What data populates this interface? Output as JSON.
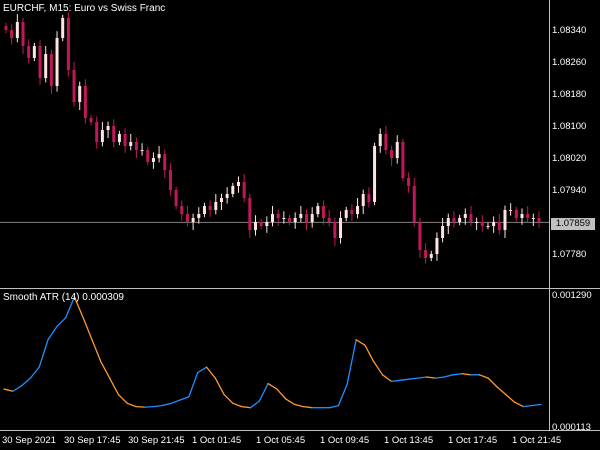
{
  "main_chart": {
    "symbol": "EURCHF",
    "timeframe": "M15",
    "description": "Euro vs Swiss Franc",
    "title_text": "EURCHF, M15:  Euro vs Swiss Franc",
    "current_price": "1.07859",
    "price_labels": [
      "1.08340",
      "1.08260",
      "1.08180",
      "1.08100",
      "1.08020",
      "1.07940",
      "1.07780"
    ],
    "colors": {
      "background": "#000000",
      "bull": "#ffe4e1",
      "bear": "#c2185b",
      "grid": "#808080",
      "price_line": "#808080"
    }
  },
  "indicator": {
    "title_text": "Smooth ATR (14) 0.000309",
    "name": "Smooth ATR",
    "period": "14",
    "value": "0.000309",
    "scale_labels": [
      "0.001290",
      "0.000113"
    ],
    "colors": {
      "rising": "#1e90ff",
      "falling": "#ff9933"
    }
  },
  "time_axis": {
    "labels": [
      "30 Sep 2021",
      "30 Sep 17:45",
      "30 Sep 21:45",
      "1 Oct 01:45",
      "1 Oct 05:45",
      "1 Oct 09:45",
      "1 Oct 13:45",
      "1 Oct 17:45",
      "1 Oct 21:45"
    ]
  },
  "chart_data": [
    {
      "type": "candlestick",
      "title": "EURCHF, M15:  Euro vs Swiss Franc",
      "ylim": [
        1.0773,
        1.0838
      ],
      "close": [
        1.0834,
        1.0832,
        1.0836,
        1.083,
        1.0827,
        1.083,
        1.0822,
        1.0828,
        1.082,
        1.0832,
        1.0837,
        1.0824,
        1.0816,
        1.082,
        1.0812,
        1.0811,
        1.0806,
        1.0809,
        1.081,
        1.0806,
        1.0808,
        1.0805,
        1.0806,
        1.0804,
        1.0804,
        1.0801,
        1.0802,
        1.0803,
        1.0799,
        1.0794,
        1.079,
        1.0788,
        1.0786,
        1.0787,
        1.0788,
        1.079,
        1.0789,
        1.0791,
        1.0792,
        1.0793,
        1.0795,
        1.0796,
        1.0792,
        1.0784,
        1.0786,
        1.0785,
        1.0786,
        1.0788,
        1.0787,
        1.0787,
        1.0786,
        1.0787,
        1.0788,
        1.0786,
        1.0788,
        1.079,
        1.0787,
        1.0786,
        1.0782,
        1.0787,
        1.0789,
        1.0788,
        1.079,
        1.0793,
        1.0791,
        1.0805,
        1.0808,
        1.0804,
        1.0802,
        1.0806,
        1.0797,
        1.0795,
        1.0786,
        1.0779,
        1.0777,
        1.0778,
        1.0782,
        1.0785,
        1.0787,
        1.0786,
        1.0787,
        1.0788,
        1.0786,
        1.0786,
        1.0785,
        1.0785,
        1.0786,
        1.0784,
        1.0789,
        1.0789,
        1.0787,
        1.0788,
        1.0787,
        1.0787,
        1.0786
      ],
      "series": [
        {
          "name": "EURCHF",
          "values": "close"
        }
      ]
    },
    {
      "type": "line",
      "title": "Smooth ATR (14) 0.000309",
      "ylim": [
        0.000113,
        0.00129
      ],
      "values": [
        0.00045,
        0.00043,
        0.00048,
        0.00055,
        0.00065,
        0.0009,
        0.00102,
        0.0011,
        0.00129,
        0.0011,
        0.0009,
        0.0007,
        0.00055,
        0.0004,
        0.00032,
        0.00029,
        0.000285,
        0.00029,
        0.0003,
        0.00032,
        0.00035,
        0.00038,
        0.0006,
        0.00065,
        0.00055,
        0.0004,
        0.00032,
        0.00029,
        0.00028,
        0.00034,
        0.0005,
        0.00045,
        0.00036,
        0.00031,
        0.00029,
        0.00028,
        0.00028,
        0.00028,
        0.0003,
        0.0005,
        0.0009,
        0.00085,
        0.0007,
        0.00058,
        0.00052,
        0.00053,
        0.00054,
        0.00055,
        0.00056,
        0.00055,
        0.00056,
        0.00058,
        0.00059,
        0.00058,
        0.00058,
        0.00055,
        0.00047,
        0.0004,
        0.00033,
        0.00029,
        0.0003,
        0.00031
      ],
      "series": [
        {
          "name": "Smooth ATR (14)",
          "values": "values"
        }
      ]
    }
  ]
}
